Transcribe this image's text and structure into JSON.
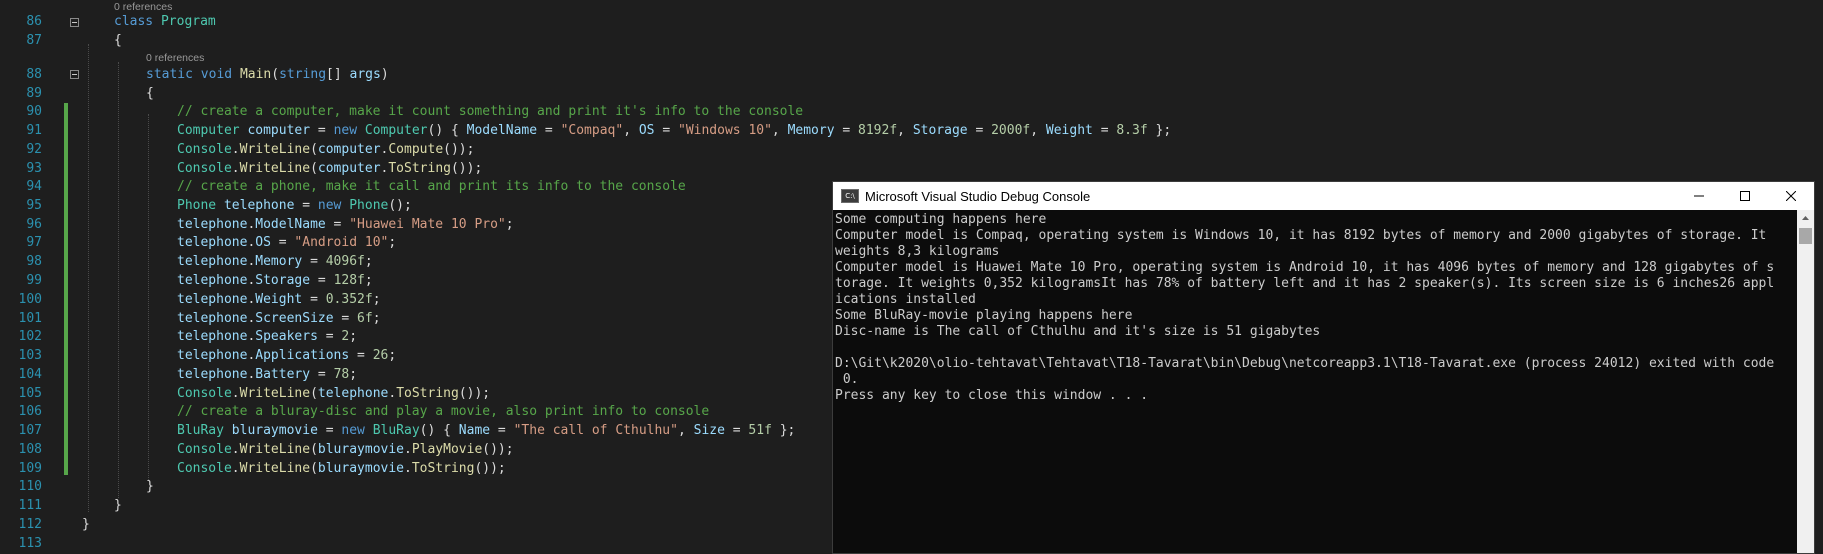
{
  "editor": {
    "codelens_class": "0 references",
    "codelens_main": "0 references",
    "lines": [
      {
        "num": "86",
        "tokens": [
          {
            "t": "class ",
            "c": "kw"
          },
          {
            "t": "Program",
            "c": "ty"
          }
        ]
      },
      {
        "num": "87",
        "tokens": [
          {
            "t": "{",
            "c": "pu"
          }
        ]
      },
      {
        "num": "88",
        "tokens": [
          {
            "t": "static ",
            "c": "kw"
          },
          {
            "t": "void ",
            "c": "kw"
          },
          {
            "t": "Main",
            "c": "me"
          },
          {
            "t": "(",
            "c": "pu"
          },
          {
            "t": "string",
            "c": "kw"
          },
          {
            "t": "[] ",
            "c": "pu"
          },
          {
            "t": "args",
            "c": "va"
          },
          {
            "t": ")",
            "c": "pu"
          }
        ]
      },
      {
        "num": "89",
        "tokens": [
          {
            "t": "{",
            "c": "pu"
          }
        ]
      },
      {
        "num": "90",
        "tokens": [
          {
            "t": "// create a computer, make it count something and print it's info to the console",
            "c": "cm"
          }
        ]
      },
      {
        "num": "91",
        "tokens": [
          {
            "t": "Computer ",
            "c": "ty"
          },
          {
            "t": "computer",
            "c": "va"
          },
          {
            "t": " = ",
            "c": "pu"
          },
          {
            "t": "new ",
            "c": "kw"
          },
          {
            "t": "Computer",
            "c": "ty"
          },
          {
            "t": "() { ",
            "c": "pu"
          },
          {
            "t": "ModelName",
            "c": "va"
          },
          {
            "t": " = ",
            "c": "pu"
          },
          {
            "t": "\"Compaq\"",
            "c": "st"
          },
          {
            "t": ", ",
            "c": "pu"
          },
          {
            "t": "OS",
            "c": "va"
          },
          {
            "t": " = ",
            "c": "pu"
          },
          {
            "t": "\"Windows 10\"",
            "c": "st"
          },
          {
            "t": ", ",
            "c": "pu"
          },
          {
            "t": "Memory",
            "c": "va"
          },
          {
            "t": " = ",
            "c": "pu"
          },
          {
            "t": "8192f",
            "c": "nu"
          },
          {
            "t": ", ",
            "c": "pu"
          },
          {
            "t": "Storage",
            "c": "va"
          },
          {
            "t": " = ",
            "c": "pu"
          },
          {
            "t": "2000f",
            "c": "nu"
          },
          {
            "t": ", ",
            "c": "pu"
          },
          {
            "t": "Weight",
            "c": "va"
          },
          {
            "t": " = ",
            "c": "pu"
          },
          {
            "t": "8.3f",
            "c": "nu"
          },
          {
            "t": " };",
            "c": "pu"
          }
        ]
      },
      {
        "num": "92",
        "tokens": [
          {
            "t": "Console",
            "c": "ty"
          },
          {
            "t": ".",
            "c": "pu"
          },
          {
            "t": "WriteLine",
            "c": "me"
          },
          {
            "t": "(",
            "c": "pu"
          },
          {
            "t": "computer",
            "c": "va"
          },
          {
            "t": ".",
            "c": "pu"
          },
          {
            "t": "Compute",
            "c": "me"
          },
          {
            "t": "());",
            "c": "pu"
          }
        ]
      },
      {
        "num": "93",
        "tokens": [
          {
            "t": "Console",
            "c": "ty"
          },
          {
            "t": ".",
            "c": "pu"
          },
          {
            "t": "WriteLine",
            "c": "me"
          },
          {
            "t": "(",
            "c": "pu"
          },
          {
            "t": "computer",
            "c": "va"
          },
          {
            "t": ".",
            "c": "pu"
          },
          {
            "t": "ToString",
            "c": "me"
          },
          {
            "t": "());",
            "c": "pu"
          }
        ]
      },
      {
        "num": "94",
        "tokens": [
          {
            "t": "// create a phone, make it call and print its info to the console",
            "c": "cm"
          }
        ]
      },
      {
        "num": "95",
        "tokens": [
          {
            "t": "Phone ",
            "c": "ty"
          },
          {
            "t": "telephone",
            "c": "va"
          },
          {
            "t": " = ",
            "c": "pu"
          },
          {
            "t": "new ",
            "c": "kw"
          },
          {
            "t": "Phone",
            "c": "ty"
          },
          {
            "t": "();",
            "c": "pu"
          }
        ]
      },
      {
        "num": "96",
        "tokens": [
          {
            "t": "telephone",
            "c": "va"
          },
          {
            "t": ".",
            "c": "pu"
          },
          {
            "t": "ModelName",
            "c": "va"
          },
          {
            "t": " = ",
            "c": "pu"
          },
          {
            "t": "\"Huawei Mate 10 Pro\"",
            "c": "st"
          },
          {
            "t": ";",
            "c": "pu"
          }
        ]
      },
      {
        "num": "97",
        "tokens": [
          {
            "t": "telephone",
            "c": "va"
          },
          {
            "t": ".",
            "c": "pu"
          },
          {
            "t": "OS",
            "c": "va"
          },
          {
            "t": " = ",
            "c": "pu"
          },
          {
            "t": "\"Android 10\"",
            "c": "st"
          },
          {
            "t": ";",
            "c": "pu"
          }
        ]
      },
      {
        "num": "98",
        "tokens": [
          {
            "t": "telephone",
            "c": "va"
          },
          {
            "t": ".",
            "c": "pu"
          },
          {
            "t": "Memory",
            "c": "va"
          },
          {
            "t": " = ",
            "c": "pu"
          },
          {
            "t": "4096f",
            "c": "nu"
          },
          {
            "t": ";",
            "c": "pu"
          }
        ]
      },
      {
        "num": "99",
        "tokens": [
          {
            "t": "telephone",
            "c": "va"
          },
          {
            "t": ".",
            "c": "pu"
          },
          {
            "t": "Storage",
            "c": "va"
          },
          {
            "t": " = ",
            "c": "pu"
          },
          {
            "t": "128f",
            "c": "nu"
          },
          {
            "t": ";",
            "c": "pu"
          }
        ]
      },
      {
        "num": "100",
        "tokens": [
          {
            "t": "telephone",
            "c": "va"
          },
          {
            "t": ".",
            "c": "pu"
          },
          {
            "t": "Weight",
            "c": "va"
          },
          {
            "t": " = ",
            "c": "pu"
          },
          {
            "t": "0.352f",
            "c": "nu"
          },
          {
            "t": ";",
            "c": "pu"
          }
        ]
      },
      {
        "num": "101",
        "tokens": [
          {
            "t": "telephone",
            "c": "va"
          },
          {
            "t": ".",
            "c": "pu"
          },
          {
            "t": "ScreenSize",
            "c": "va"
          },
          {
            "t": " = ",
            "c": "pu"
          },
          {
            "t": "6f",
            "c": "nu"
          },
          {
            "t": ";",
            "c": "pu"
          }
        ]
      },
      {
        "num": "102",
        "tokens": [
          {
            "t": "telephone",
            "c": "va"
          },
          {
            "t": ".",
            "c": "pu"
          },
          {
            "t": "Speakers",
            "c": "va"
          },
          {
            "t": " = ",
            "c": "pu"
          },
          {
            "t": "2",
            "c": "nu"
          },
          {
            "t": ";",
            "c": "pu"
          }
        ]
      },
      {
        "num": "103",
        "tokens": [
          {
            "t": "telephone",
            "c": "va"
          },
          {
            "t": ".",
            "c": "pu"
          },
          {
            "t": "Applications",
            "c": "va"
          },
          {
            "t": " = ",
            "c": "pu"
          },
          {
            "t": "26",
            "c": "nu"
          },
          {
            "t": ";",
            "c": "pu"
          }
        ]
      },
      {
        "num": "104",
        "tokens": [
          {
            "t": "telephone",
            "c": "va"
          },
          {
            "t": ".",
            "c": "pu"
          },
          {
            "t": "Battery",
            "c": "va"
          },
          {
            "t": " = ",
            "c": "pu"
          },
          {
            "t": "78",
            "c": "nu"
          },
          {
            "t": ";",
            "c": "pu"
          }
        ]
      },
      {
        "num": "105",
        "tokens": [
          {
            "t": "Console",
            "c": "ty"
          },
          {
            "t": ".",
            "c": "pu"
          },
          {
            "t": "WriteLine",
            "c": "me"
          },
          {
            "t": "(",
            "c": "pu"
          },
          {
            "t": "telephone",
            "c": "va"
          },
          {
            "t": ".",
            "c": "pu"
          },
          {
            "t": "ToString",
            "c": "me"
          },
          {
            "t": "());",
            "c": "pu"
          }
        ]
      },
      {
        "num": "106",
        "tokens": [
          {
            "t": "// create a bluray-disc and play a movie, also print info to console",
            "c": "cm"
          }
        ]
      },
      {
        "num": "107",
        "tokens": [
          {
            "t": "BluRay ",
            "c": "ty"
          },
          {
            "t": "bluraymovie",
            "c": "va"
          },
          {
            "t": " = ",
            "c": "pu"
          },
          {
            "t": "new ",
            "c": "kw"
          },
          {
            "t": "BluRay",
            "c": "ty"
          },
          {
            "t": "() { ",
            "c": "pu"
          },
          {
            "t": "Name",
            "c": "va"
          },
          {
            "t": " = ",
            "c": "pu"
          },
          {
            "t": "\"The call of Cthulhu\"",
            "c": "st"
          },
          {
            "t": ", ",
            "c": "pu"
          },
          {
            "t": "Size",
            "c": "va"
          },
          {
            "t": " = ",
            "c": "pu"
          },
          {
            "t": "51f",
            "c": "nu"
          },
          {
            "t": " };",
            "c": "pu"
          }
        ]
      },
      {
        "num": "108",
        "tokens": [
          {
            "t": "Console",
            "c": "ty"
          },
          {
            "t": ".",
            "c": "pu"
          },
          {
            "t": "WriteLine",
            "c": "me"
          },
          {
            "t": "(",
            "c": "pu"
          },
          {
            "t": "bluraymovie",
            "c": "va"
          },
          {
            "t": ".",
            "c": "pu"
          },
          {
            "t": "PlayMovie",
            "c": "me"
          },
          {
            "t": "());",
            "c": "pu"
          }
        ]
      },
      {
        "num": "109",
        "tokens": [
          {
            "t": "Console",
            "c": "ty"
          },
          {
            "t": ".",
            "c": "pu"
          },
          {
            "t": "WriteLine",
            "c": "me"
          },
          {
            "t": "(",
            "c": "pu"
          },
          {
            "t": "bluraymovie",
            "c": "va"
          },
          {
            "t": ".",
            "c": "pu"
          },
          {
            "t": "ToString",
            "c": "me"
          },
          {
            "t": "());",
            "c": "pu"
          }
        ]
      },
      {
        "num": "110",
        "tokens": [
          {
            "t": "}",
            "c": "pu"
          }
        ]
      },
      {
        "num": "111",
        "tokens": [
          {
            "t": "}",
            "c": "pu"
          }
        ]
      },
      {
        "num": "112",
        "tokens": [
          {
            "t": "}",
            "c": "pu"
          }
        ]
      },
      {
        "num": "113",
        "tokens": []
      }
    ]
  },
  "console": {
    "title": "Microsoft Visual Studio Debug Console",
    "icon": "console-app-icon",
    "icon_text": "C:\\",
    "lines": [
      "Some computing happens here",
      "Computer model is Compaq, operating system is Windows 10, it has 8192 bytes of memory and 2000 gigabytes of storage. It",
      "weights 8,3 kilograms",
      "Computer model is Huawei Mate 10 Pro, operating system is Android 10, it has 4096 bytes of memory and 128 gigabytes of s",
      "torage. It weights 0,352 kilogramsIt has 78% of battery left and it has 2 speaker(s). Its screen size is 6 inches26 appl",
      "ications installed",
      "Some BluRay-movie playing happens here",
      "Disc-name is The call of Cthulhu and it's size is 51 gigabytes",
      "",
      "D:\\Git\\k2020\\olio-tehtavat\\Tehtavat\\T18-Tavarat\\bin\\Debug\\netcoreapp3.1\\T18-Tavarat.exe (process 24012) exited with code",
      " 0.",
      "Press any key to close this window . . ."
    ]
  },
  "colors": {
    "editor_bg": "#1e1e1e",
    "line_number": "#2b91af",
    "keyword": "#569cd6",
    "type": "#4ec9b0",
    "method": "#dcdcaa",
    "variable": "#9cdcfe",
    "string": "#d69d85",
    "number": "#b5cea8",
    "comment": "#57a64a",
    "console_bg": "#0c0c0c",
    "console_text": "#cccccc"
  }
}
